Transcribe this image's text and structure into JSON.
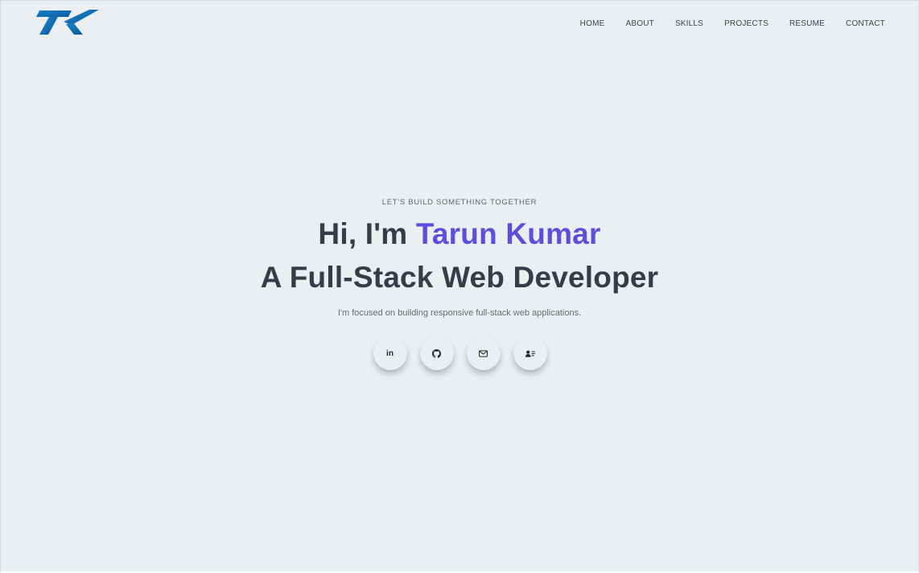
{
  "header": {
    "logo_icon": "tk-monogram-logo",
    "brand_color": "#0f6db3",
    "nav": [
      {
        "label": "HOME"
      },
      {
        "label": "ABOUT"
      },
      {
        "label": "SKILLS"
      },
      {
        "label": "PROJECTS"
      },
      {
        "label": "RESUME"
      },
      {
        "label": "CONTACT"
      }
    ]
  },
  "hero": {
    "eyebrow": "LET'S BUILD SOMETHING TOGETHER",
    "greeting": "Hi, I'm ",
    "name": "Tarun Kumar",
    "subhead": "A Full-Stack Web Developer",
    "tagline": "I'm focused on building responsive full-stack web applications.",
    "name_color": "#5b4fdc",
    "text_color": "#383c48",
    "socials": [
      {
        "icon": "linkedin-icon",
        "glyph": "in"
      },
      {
        "icon": "github-icon"
      },
      {
        "icon": "mail-icon"
      },
      {
        "icon": "contact-card-icon"
      }
    ]
  },
  "colors": {
    "background": "#eceff2"
  }
}
